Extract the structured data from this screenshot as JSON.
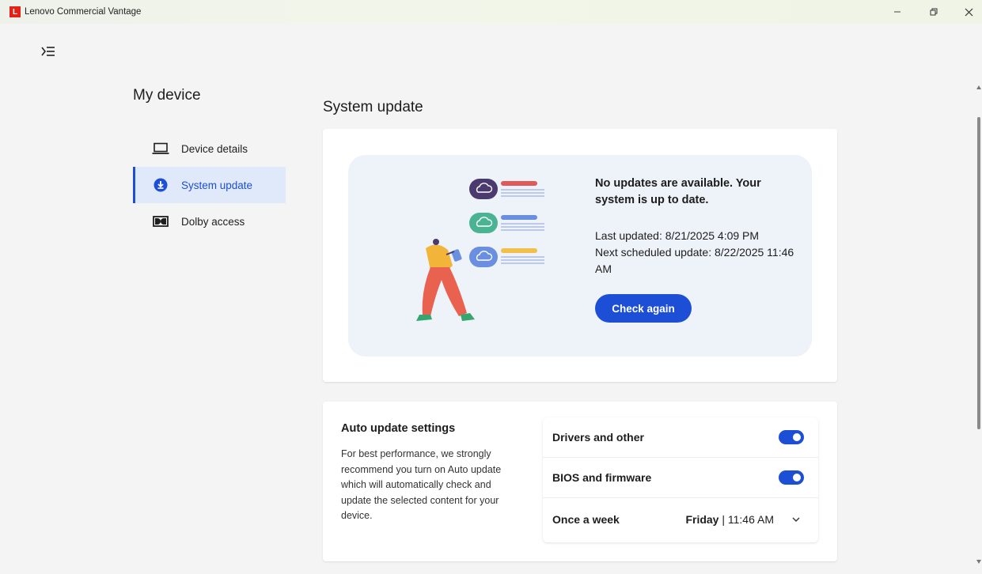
{
  "window": {
    "app_logo": "L",
    "title": "Lenovo Commercial Vantage",
    "controls": {
      "minimize": "–",
      "maximize": "▢",
      "close": "✕"
    }
  },
  "sidebar": {
    "title": "My device",
    "items": [
      {
        "label": "Device details",
        "icon": "laptop-icon",
        "active": false
      },
      {
        "label": "System update",
        "icon": "download-circle-icon",
        "active": true
      },
      {
        "label": "Dolby access",
        "icon": "dolby-icon",
        "active": false
      }
    ]
  },
  "main": {
    "title": "System update",
    "status": {
      "message": "No updates are available. Your system is up to date.",
      "last_updated": "Last updated: 8/21/2025 4:09 PM",
      "next_update": "Next scheduled update: 8/22/2025 11:46 AM",
      "button_label": "Check again"
    },
    "auto_update": {
      "title": "Auto update settings",
      "description": "For best performance, we strongly recommend you turn on Auto update which will automatically check and update the selected content for your device.",
      "settings": [
        {
          "label": "Drivers and other",
          "enabled": true
        },
        {
          "label": "BIOS and firmware",
          "enabled": true
        }
      ],
      "schedule": {
        "frequency": "Once a week",
        "day": "Friday",
        "separator": " | ",
        "time": "11:46 AM"
      }
    }
  },
  "colors": {
    "accent": "#1d4fd6",
    "active_nav_bg": "#dfe9f9",
    "brand_red": "#e2231a"
  }
}
